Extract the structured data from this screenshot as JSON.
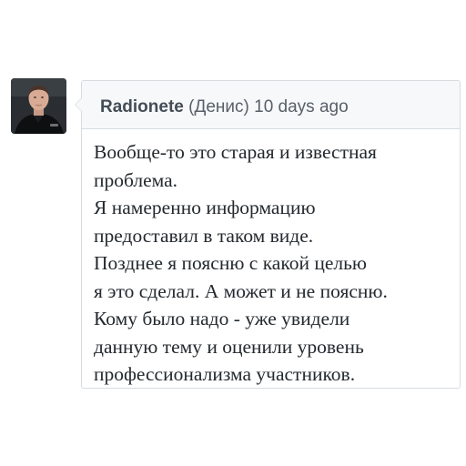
{
  "comment": {
    "author": "Radionete",
    "display_name": "(Денис)",
    "timestamp": "10 days ago",
    "avatar_icon": "user-avatar-photo",
    "body_lines": [
      "Вообще-то это старая и известная",
      "проблема.",
      "Я намеренно информацию",
      "предоставил в таком виде.",
      "Позднее я поясню с какой целью",
      "я это сделал. А может и не поясню.",
      "Кому было надо - уже увидели",
      "данную тему и оценили уровень",
      "профессионализма участников."
    ]
  }
}
